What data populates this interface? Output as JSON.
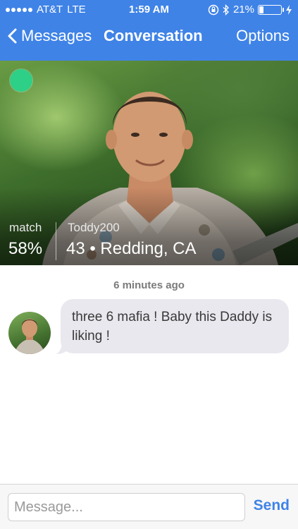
{
  "status_bar": {
    "carrier": "AT&T",
    "network": "LTE",
    "time": "1:59 AM",
    "battery_percent": "21%",
    "battery_level": 0.21
  },
  "nav": {
    "back_label": "Messages",
    "title": "Conversation",
    "options_label": "Options"
  },
  "profile": {
    "match_label": "match",
    "match_value": "58%",
    "username": "Toddy200",
    "age_location": "43 • Redding, CA",
    "online_color": "#2ecf86"
  },
  "conversation": {
    "timestamp": "6 minutes ago",
    "messages": [
      {
        "text": "three 6 mafia ! Baby this Daddy is liking !"
      }
    ]
  },
  "composer": {
    "placeholder": "Message...",
    "send_label": "Send"
  },
  "colors": {
    "accent": "#3f83e7",
    "bubble": "#e8e8ee"
  }
}
